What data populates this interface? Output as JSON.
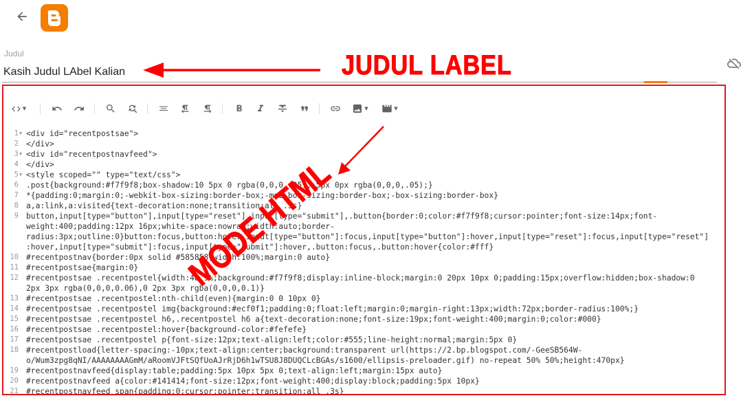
{
  "title_field": {
    "label": "Judul",
    "value": "Kasih Judul LAbel Kalian"
  },
  "annotations": {
    "judul_label": "JUDUL LABEL",
    "mode_html": "MODE HTML"
  },
  "icons": {
    "back": "arrow-left-icon",
    "logo": "blogger-logo-icon",
    "cloud_off": "cloud-off-icon"
  },
  "colors": {
    "accent": "#f57d00",
    "annotation": "#ff0000",
    "editor_border": "#e0161b"
  },
  "code_lines": [
    {
      "n": "1",
      "fold": true,
      "text": "<div id=\"recentpostsae\">"
    },
    {
      "n": "2",
      "fold": false,
      "text": "</div>"
    },
    {
      "n": "3",
      "fold": true,
      "text": "<div id=\"recentpostnavfeed\">"
    },
    {
      "n": "4",
      "fold": false,
      "text": "</div>"
    },
    {
      "n": "5",
      "fold": true,
      "text": "<style scoped=\"\" type=\"text/css\">"
    },
    {
      "n": "6",
      "fold": false,
      "text": ".post{background:#f7f9f8;box-shadow:10 5px 0 rgba(0,0,0,.05), 5px 0px rgba(0,0,0,.05);}"
    },
    {
      "n": "7",
      "fold": false,
      "text": "*{padding:0;margin:0;-webkit-box-sizing:border-box;-moz-box-sizing:border-box;-box-sizing:border-box}"
    },
    {
      "n": "8",
      "fold": false,
      "text": "a,a:link,a:visited{text-decoration:none;transition:all .3s}"
    },
    {
      "n": "9",
      "fold": false,
      "text": "button,input[type=\"button\"],input[type=\"reset\"],input[type=\"submit\"],.button{border:0;color:#f7f9f8;cursor:pointer;font-size:14px;font-"
    },
    {
      "n": "",
      "fold": false,
      "text": "weight:400;padding:12px 16px;white-space:nowrap;width:auto;border-"
    },
    {
      "n": "",
      "fold": false,
      "text": "radius:3px;outline:0}button:focus,button:hover,input[type=\"button\"]:focus,input[type=\"button\"]:hover,input[type=\"reset\"]:focus,input[type=\"reset\"]"
    },
    {
      "n": "",
      "fold": false,
      "text": ":hover,input[type=\"submit\"]:focus,input[type=\"submit\"]:hover,.button:focus,.button:hover{color:#fff}"
    },
    {
      "n": "10",
      "fold": false,
      "text": "#recentpostnav{border:0px solid #585858;width:100%;margin:0 auto}"
    },
    {
      "n": "11",
      "fold": false,
      "text": "#recentpostsae{margin:0}"
    },
    {
      "n": "12",
      "fold": false,
      "text": "#recentpostsae .recentpostel{width:48.9%;background:#f7f9f8;display:inline-block;margin:0 20px 10px 0;padding:15px;overflow:hidden;box-shadow:0"
    },
    {
      "n": "",
      "fold": false,
      "text": "2px 3px rgba(0,0,0,0.06),0 2px 3px rgba(0,0,0,0.1)}"
    },
    {
      "n": "13",
      "fold": false,
      "text": "#recentpostsae .recentpostel:nth-child(even){margin:0 0 10px 0}"
    },
    {
      "n": "14",
      "fold": false,
      "text": "#recentpostsae .recentpostel img{background:#ecf0f1;padding:0;float:left;margin:0;margin-right:13px;width:72px;border-radius:100%;}"
    },
    {
      "n": "15",
      "fold": false,
      "text": "#recentpostsae .recentpostel h6,.recentpostel h6 a{text-decoration:none;font-size:19px;font-weight:400;margin:0;color:#000}"
    },
    {
      "n": "16",
      "fold": false,
      "text": "#recentpostsae .recentpostel:hover{background-color:#fefefe}"
    },
    {
      "n": "17",
      "fold": false,
      "text": "#recentpostsae .recentpostel p{font-size:12px;text-align:left;color:#555;line-height:normal;margin:5px 0}"
    },
    {
      "n": "18",
      "fold": false,
      "text": "#recentpostload{letter-spacing:-10px;text-align:center;background:transparent url(https://2.bp.blogspot.com/-GeeSB564W-"
    },
    {
      "n": "",
      "fold": false,
      "text": "o/Wum3zpg8qNI/AAAAAAAAGmM/aRoomVJFtSQfUoAJrRjD6h1wTSU8J8DUQCLcBGAs/s1600/ellipsis-preloader.gif) no-repeat 50% 50%;height:470px}"
    },
    {
      "n": "19",
      "fold": false,
      "text": "#recentpostnavfeed{display:table;padding:5px 10px 5px 0;text-align:left;margin:15px auto}"
    },
    {
      "n": "20",
      "fold": false,
      "text": "#recentpostnavfeed a{color:#141414;font-size:12px;font-weight:400;display:block;padding:5px 10px}"
    },
    {
      "n": "21",
      "fold": false,
      "text": "#recentpostnavfeed span{padding:0;cursor:pointer;transition:all .3s}"
    }
  ]
}
